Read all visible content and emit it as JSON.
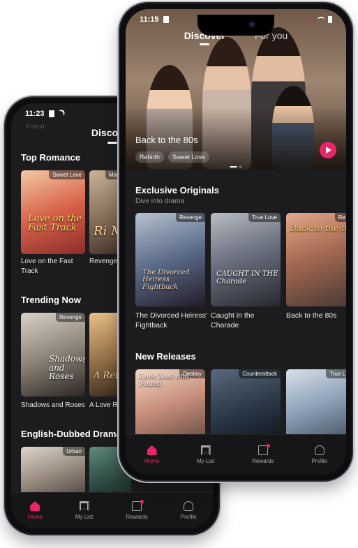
{
  "back_phone": {
    "status_time": "11:23",
    "faded_top_label": "Found",
    "title": "Discover",
    "top_romance": {
      "title": "Top Romance",
      "cards": [
        {
          "badge": "Sweet Love",
          "overlay": "Love on the Fast Track",
          "caption": "Love on the Fast Track"
        },
        {
          "badge": "Marriag",
          "overlay": "Ri M",
          "caption": "Revenge N Sweet Lov"
        }
      ]
    },
    "trending": {
      "title": "Trending Now",
      "cards": [
        {
          "badge": "Revenge",
          "overlay": "Shadows and Roses",
          "caption": "Shadows and Roses"
        },
        {
          "badge": "",
          "overlay": "A Rei",
          "caption": "A Love Re"
        }
      ]
    },
    "dubbed": {
      "title": "English-Dubbed Drama",
      "cards": [
        {
          "badge": "Urban",
          "overlay": "",
          "caption": ""
        },
        {
          "badge": "",
          "overlay": "",
          "caption": ""
        }
      ]
    },
    "tabbar": {
      "home": "Home",
      "my_list": "My List",
      "rewards": "Rewards",
      "profile": "Profile"
    }
  },
  "front_phone": {
    "status_time": "11:15",
    "tabs": {
      "discover": "Discover",
      "for_you": "For you"
    },
    "hero": {
      "title": "Back to the 80s",
      "tags": [
        "Rebirth",
        "Sweet Love"
      ]
    },
    "exclusive": {
      "title": "Exclusive Originals",
      "subtitle": "Dive into drama",
      "cards": [
        {
          "badge": "Revenge",
          "overlay": "The Divorced Heiress Fightback",
          "caption": "The Divorced Heiress' Fightback"
        },
        {
          "badge": "True Love",
          "overlay": "CAUGHT IN THE Charade",
          "caption": "Caught in the Charade"
        },
        {
          "badge": "Re",
          "overlay": "Back to the 8",
          "caption": "Back to the 80s"
        }
      ]
    },
    "new_releases": {
      "title": "New Releases",
      "cards": [
        {
          "badge": "Destiny",
          "overlay": "Love Lost and Found"
        },
        {
          "badge": "Counterattack",
          "overlay": ""
        },
        {
          "badge": "True L",
          "overlay": ""
        }
      ]
    },
    "tabbar": {
      "home": "Home",
      "my_list": "My List",
      "rewards": "Rewards",
      "profile": "Profile"
    }
  },
  "colors": {
    "accent": "#e8246a",
    "background": "#1c1c1e",
    "tabbar": "#161618"
  }
}
